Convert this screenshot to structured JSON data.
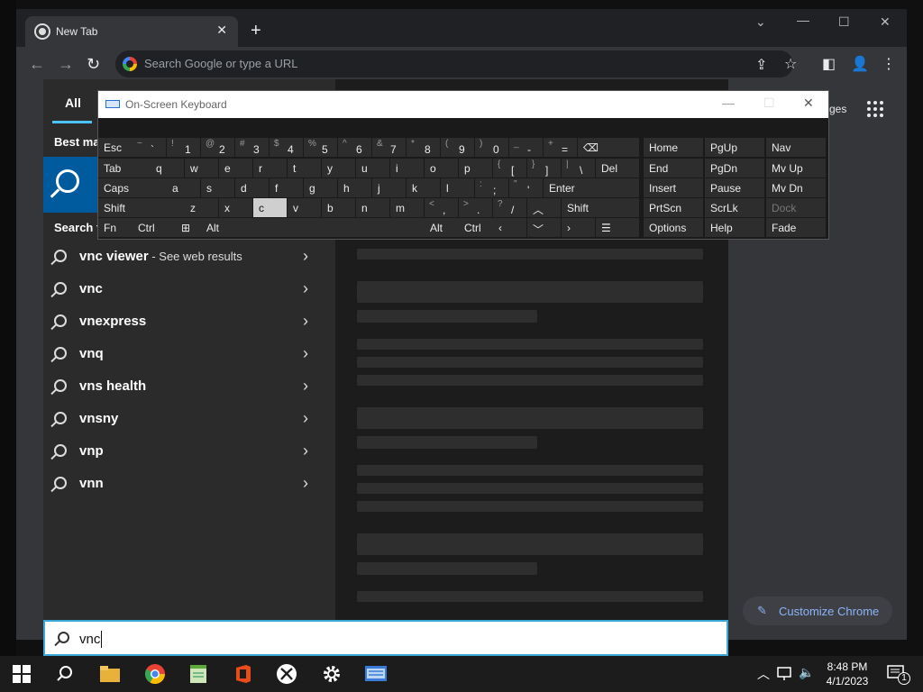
{
  "browser": {
    "tab_title": "New Tab",
    "omnibox_placeholder": "Search Google or type a URL",
    "ntp_images_label": "ges",
    "customize_label": "Customize Chrome"
  },
  "search_panel": {
    "tab_all": "All",
    "best_match_label": "Best ma",
    "search_web_label": "Search t",
    "suggestions": [
      {
        "text": "vnc viewer",
        "suffix": " - See web results"
      },
      {
        "text": "vnc",
        "suffix": ""
      },
      {
        "text": "vnexpress",
        "suffix": ""
      },
      {
        "text": "vnq",
        "suffix": ""
      },
      {
        "text": "vns health",
        "suffix": ""
      },
      {
        "text": "vnsny",
        "suffix": ""
      },
      {
        "text": "vnp",
        "suffix": ""
      },
      {
        "text": "vnn",
        "suffix": ""
      }
    ],
    "query": "vnc"
  },
  "osk": {
    "title": "On-Screen Keyboard",
    "rows": {
      "r1": [
        {
          "s": "~",
          "m": "`"
        },
        {
          "s": "!",
          "m": "1"
        },
        {
          "s": "@",
          "m": "2"
        },
        {
          "s": "#",
          "m": "3"
        },
        {
          "s": "$",
          "m": "4"
        },
        {
          "s": "%",
          "m": "5"
        },
        {
          "s": "^",
          "m": "6"
        },
        {
          "s": "&",
          "m": "7"
        },
        {
          "s": "*",
          "m": "8"
        },
        {
          "s": "(",
          "m": "9"
        },
        {
          "s": ")",
          "m": "0"
        },
        {
          "s": "_",
          "m": "-"
        },
        {
          "s": "+",
          "m": "="
        }
      ],
      "r2": [
        "q",
        "w",
        "e",
        "r",
        "t",
        "y",
        "u",
        "i",
        "o",
        "p"
      ],
      "r2b": [
        {
          "s": "{",
          "m": "["
        },
        {
          "s": "}",
          "m": "]"
        },
        {
          "s": "|",
          "m": "\\"
        }
      ],
      "r3": [
        "a",
        "s",
        "d",
        "f",
        "g",
        "h",
        "j",
        "k",
        "l"
      ],
      "r3b": [
        {
          "s": ":",
          "m": ";"
        },
        {
          "s": "\"",
          "m": "'"
        }
      ],
      "r4": [
        "z",
        "x",
        "c",
        "v",
        "b",
        "n",
        "m"
      ],
      "r4b": [
        {
          "s": "<",
          "m": ","
        },
        {
          "s": ">",
          "m": "."
        },
        {
          "s": "?",
          "m": "/"
        }
      ]
    },
    "labels": {
      "esc": "Esc",
      "tab": "Tab",
      "caps": "Caps",
      "shift": "Shift",
      "fn": "Fn",
      "ctrl": "Ctrl",
      "alt": "Alt",
      "del": "Del",
      "enter": "Enter",
      "home": "Home",
      "pgup": "PgUp",
      "nav": "Nav",
      "end": "End",
      "pgdn": "PgDn",
      "mvup": "Mv Up",
      "insert": "Insert",
      "pause": "Pause",
      "mvdn": "Mv Dn",
      "prtscn": "PrtScn",
      "scrlk": "ScrLk",
      "dock": "Dock",
      "options": "Options",
      "help": "Help",
      "fade": "Fade"
    }
  },
  "taskbar": {
    "time": "8:48 PM",
    "date": "4/1/2023",
    "notification_count": "1"
  },
  "colors": {
    "accent": "#4cc2ff",
    "link": "#8ab4f8"
  }
}
